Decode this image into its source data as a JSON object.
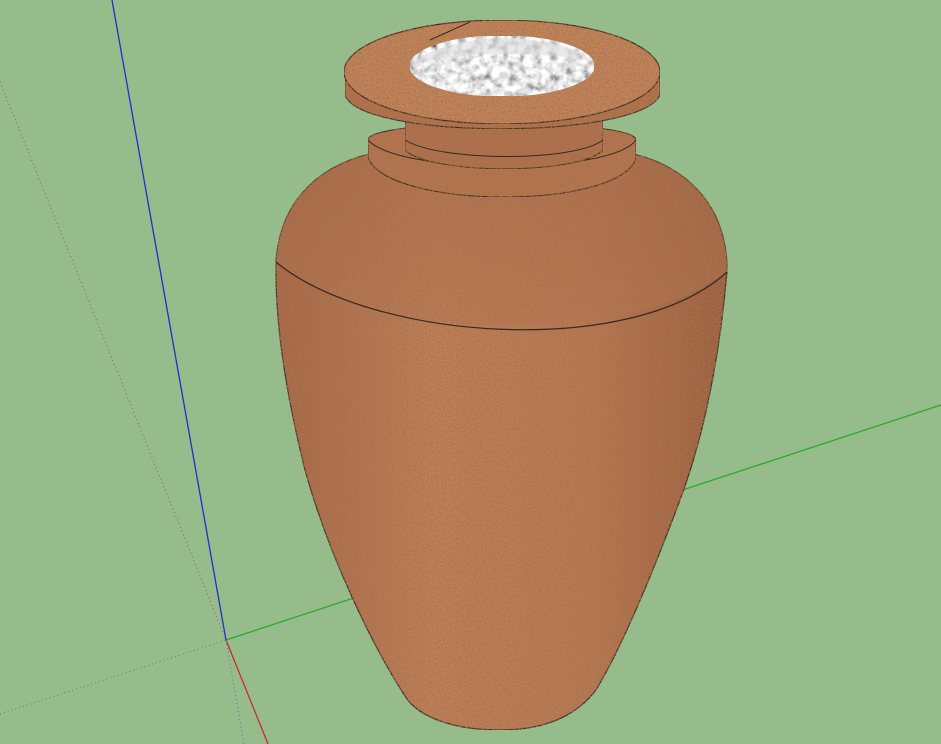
{
  "scene": {
    "object_name": "vase",
    "background_color": "#95bc8a",
    "axes": {
      "x_color": "#cc2222",
      "y_color": "#22aa22",
      "z_color": "#1f2fd0"
    },
    "material": {
      "body_color": "#b77550",
      "body_shade": "#8a4e30",
      "inner_color": "#a8a8a8",
      "edge_color": "#3a2a20"
    }
  }
}
